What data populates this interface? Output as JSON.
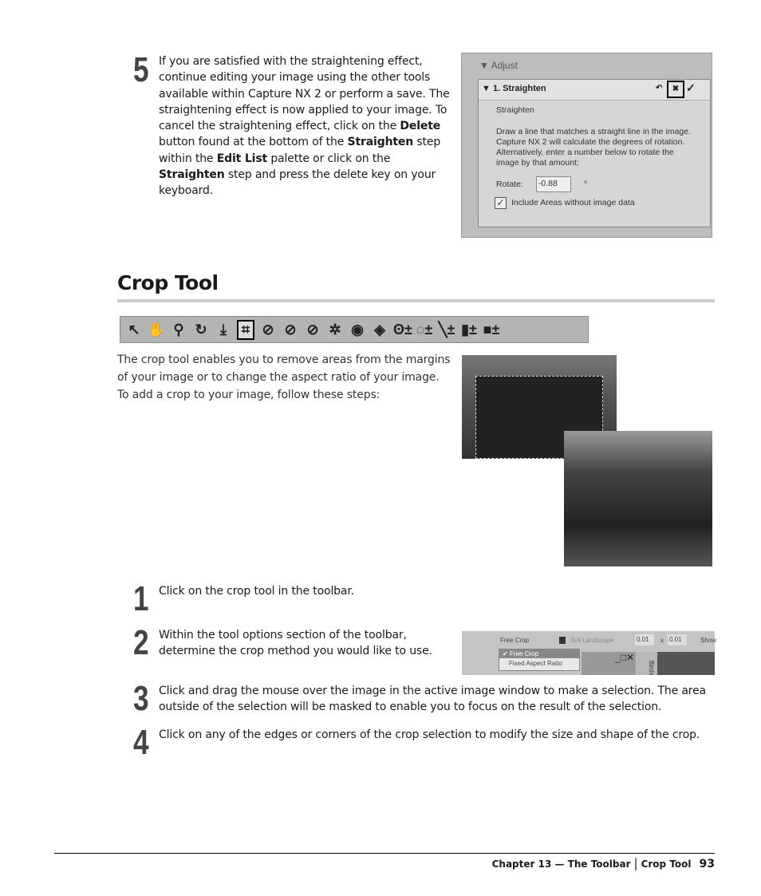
{
  "step5": {
    "num": "5",
    "text_html": "If you are satisfied with the straightening effect, continue editing your image using the other tools available within Capture NX 2 or perform a save. The straightening effect is now applied to your image. To cancel the straightening effect, click on the <b>Delete</b> button found at the bottom of the <b>Straighten</b> step within the <b>Edit List</b> palette or click on the <b>Straighten</b> step and press the delete key on your keyboard."
  },
  "panel": {
    "section": "Adjust",
    "step": "1. Straighten",
    "sub": "Straighten",
    "desc1": "Draw a line that matches a straight line in the image.",
    "desc2": "Capture NX 2 will calculate the degrees of rotation. Alternatively, enter a number below to rotate the image by that amount:",
    "rotate_label": "Rotate:",
    "rotate_value": "-0.88",
    "unit": "°",
    "checkbox_label": "Include Areas without image data",
    "checkbox_checked": true
  },
  "heading": "Crop Tool",
  "toolbar": {
    "icons": [
      "arrow-icon",
      "hand-icon",
      "zoom-icon",
      "rotate-icon",
      "straighten-icon",
      "crop-icon",
      "black-point-icon",
      "neutral-point-icon",
      "white-point-icon",
      "red-eye-icon",
      "eye-icon",
      "auto-retouch-icon",
      "lasso-icon",
      "polygon-lasso-icon",
      "brush-icon",
      "gradient-icon",
      "fill-icon"
    ]
  },
  "intro": "The crop tool enables you to remove areas from the margins of your image or to change the aspect ratio of your image. To add a crop to your image, follow these steps:",
  "steps": [
    {
      "num": "1",
      "text": "Click on the crop tool in the toolbar."
    },
    {
      "num": "2",
      "text": "Within the tool options section of the toolbar, determine the crop method you would like to use."
    },
    {
      "num": "3",
      "text": "Click and drag the mouse over the image in the active image window to make a selection. The area outside of the selection will be masked to enable you to focus on the result of the selection."
    },
    {
      "num": "4",
      "text": "Click on any of the edges or corners of the crop selection to modify the size and shape of the crop."
    }
  ],
  "cropbar": {
    "method": "Free Crop",
    "preset": "3x4 Landscape",
    "w": "0.01",
    "x": "x",
    "h": "0.01",
    "show": "Show",
    "options": [
      "Free Crop",
      "Fixed Aspect Ratio"
    ],
    "side": "Birds"
  },
  "footer": {
    "chapter": "Chapter 13 — The Toolbar",
    "section": "Crop Tool",
    "page": "93"
  }
}
